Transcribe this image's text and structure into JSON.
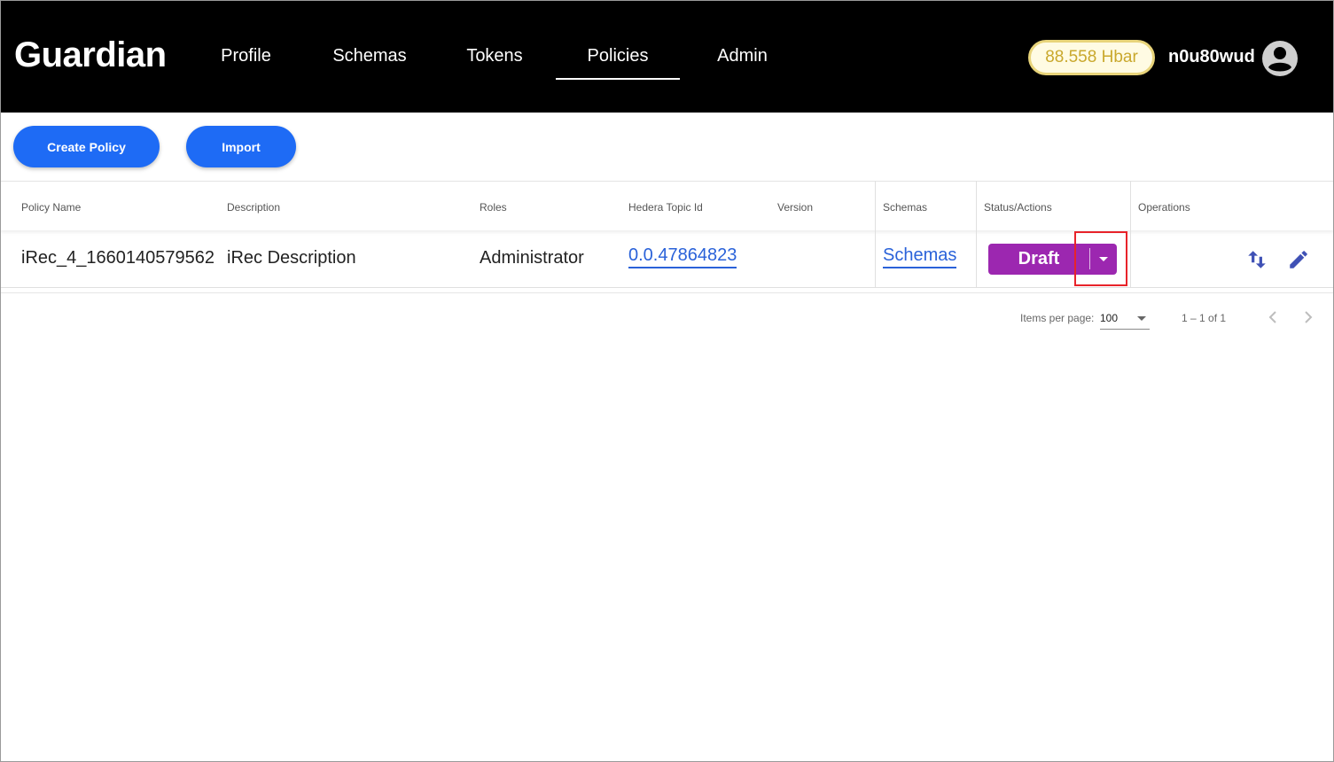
{
  "header": {
    "brand": "Guardian",
    "nav": [
      {
        "label": "Profile"
      },
      {
        "label": "Schemas"
      },
      {
        "label": "Tokens"
      },
      {
        "label": "Policies",
        "active": true
      },
      {
        "label": "Admin"
      }
    ],
    "balance": "88.558 Hbar",
    "username": "n0u80wud",
    "avatar_icon": "account-circle-icon"
  },
  "toolbar": {
    "create_policy_label": "Create Policy",
    "import_label": "Import"
  },
  "table": {
    "columns": [
      "Policy Name",
      "Description",
      "Roles",
      "Hedera Topic Id",
      "Version",
      "Schemas",
      "Status/Actions",
      "Operations"
    ],
    "rows": [
      {
        "policy_name": "iRec_4_1660140579562",
        "description": "iRec Description",
        "roles": "Administrator",
        "topic_id": "0.0.47864823",
        "version": "",
        "schemas_link": "Schemas",
        "status": "Draft",
        "operations": [
          "swap-vert-icon",
          "edit-pencil-icon"
        ]
      }
    ]
  },
  "paginator": {
    "items_per_page_label": "Items per page:",
    "page_size": "100",
    "range_label": "1 – 1 of 1"
  },
  "colors": {
    "header_bg": "#000000",
    "primary_button": "#1e6bf5",
    "status_draft": "#9c27b0",
    "link": "#2a62d9",
    "balance_text": "#c9a82d",
    "highlight": "#e8232a"
  }
}
